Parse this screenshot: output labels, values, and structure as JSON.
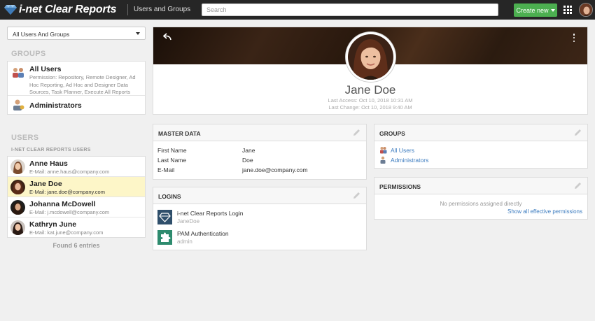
{
  "header": {
    "app_title": "i-net Clear Reports",
    "section_title": "Users and Groups",
    "search_placeholder": "Search",
    "create_button": "Create new",
    "icons": [
      "gem-logo-icon",
      "apps-grid-icon",
      "user-avatar-icon"
    ]
  },
  "sidebar": {
    "filter_selected": "All Users And Groups",
    "groups_heading": "GROUPS",
    "groups": [
      {
        "name": "All Users",
        "description": "Permission: Repository, Remote Designer, Ad Hoc Reporting, Ad Hoc and Designer Data Sources, Task Planner, Execute All Reports"
      },
      {
        "name": "Administrators",
        "description": ""
      }
    ],
    "users_heading": "USERS",
    "users_subheading": "I-NET CLEAR REPORTS USERS",
    "users": [
      {
        "name": "Anne Haus",
        "email": "E-Mail: anne.haus@company.com",
        "selected": false
      },
      {
        "name": "Jane Doe",
        "email": "E-Mail: jane.doe@company.com",
        "selected": true
      },
      {
        "name": "Johanna McDowell",
        "email": "E-Mail: j.mcdowell@company.com",
        "selected": false
      },
      {
        "name": "Kathryn June",
        "email": "E-Mail: kat.june@company.com",
        "selected": false
      }
    ],
    "found_text": "Found 6 entries"
  },
  "profile": {
    "name": "Jane Doe",
    "last_access": "Last Access: Oct 10, 2018 10:31 AM",
    "last_change": "Last Change: Oct 10, 2018 9:40 AM"
  },
  "master_data": {
    "title": "MASTER DATA",
    "rows": [
      {
        "label": "First Name",
        "value": "Jane"
      },
      {
        "label": "Last Name",
        "value": "Doe"
      },
      {
        "label": "E-Mail",
        "value": "jane.doe@company.com"
      }
    ]
  },
  "logins": {
    "title": "LOGINS",
    "items": [
      {
        "name": "i-net Clear Reports Login",
        "user": "JaneDoe"
      },
      {
        "name": "PAM Authentication",
        "user": "admin"
      }
    ]
  },
  "groups_card": {
    "title": "GROUPS",
    "items": [
      "All Users",
      "Administrators"
    ]
  },
  "permissions": {
    "title": "PERMISSIONS",
    "none_text": "No permissions assigned directly",
    "link_text": "Show all effective permissions"
  },
  "colors": {
    "topbar": "#262626",
    "create_button": "#4caf50",
    "link": "#3b7bbf",
    "selected_row": "#fdf6c8"
  }
}
